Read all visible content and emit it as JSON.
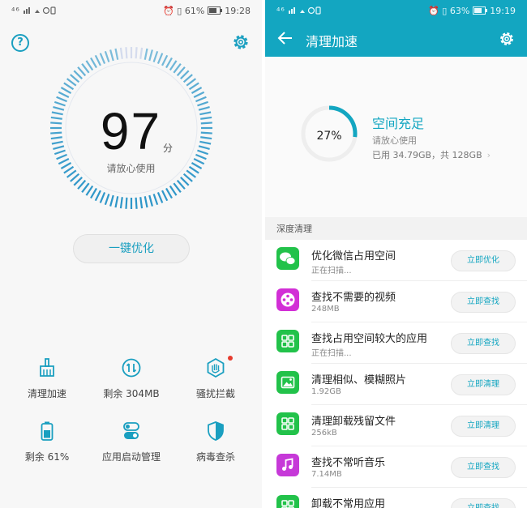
{
  "left": {
    "status": {
      "signal": "⁴⁶",
      "battery": "61%",
      "time": "19:28"
    },
    "score": "97",
    "score_unit": "分",
    "score_subtitle": "请放心使用",
    "optimize_label": "一键优化",
    "features": [
      {
        "label": "清理加速",
        "icon": "broom-icon"
      },
      {
        "label": "剩余 304MB",
        "icon": "memory-icon"
      },
      {
        "label": "骚扰拦截",
        "icon": "hand-block-icon"
      },
      {
        "label": "剩余 61%",
        "icon": "battery-icon"
      },
      {
        "label": "应用启动管理",
        "icon": "toggle-icon"
      },
      {
        "label": "病毒查杀",
        "icon": "shield-icon"
      }
    ]
  },
  "right": {
    "status": {
      "signal": "⁴⁶",
      "battery": "63%",
      "time": "19:19"
    },
    "title": "清理加速",
    "storage": {
      "percent_label": "27%",
      "percent": 27,
      "headline": "空间充足",
      "subtitle": "请放心使用",
      "detail": "已用 34.79GB，共 128GB"
    },
    "section_label": "深度清理",
    "items": [
      {
        "title": "优化微信占用空间",
        "sub": "正在扫描...",
        "button": "立即优化",
        "color": "#22c24a",
        "icon": "wechat-icon"
      },
      {
        "title": "查找不需要的视频",
        "sub": "248MB",
        "button": "立即查找",
        "color": "#d22fd6",
        "icon": "film-reel-icon"
      },
      {
        "title": "查找占用空间较大的应用",
        "sub": "正在扫描...",
        "button": "立即查找",
        "color": "#22c24a",
        "icon": "grid-apps-icon"
      },
      {
        "title": "清理相似、模糊照片",
        "sub": "1.92GB",
        "button": "立即清理",
        "color": "#22c24a",
        "icon": "photo-icon"
      },
      {
        "title": "清理卸载残留文件",
        "sub": "256kB",
        "button": "立即清理",
        "color": "#22c24a",
        "icon": "grid-apps-icon"
      },
      {
        "title": "查找不常听音乐",
        "sub": "7.14MB",
        "button": "立即查找",
        "color": "#c639d8",
        "icon": "music-note-icon"
      },
      {
        "title": "卸载不常用应用",
        "sub": "",
        "button": "立即查找",
        "color": "#22c24a",
        "icon": "grid-apps-icon"
      }
    ]
  },
  "colors": {
    "accent": "#13a6c1",
    "green": "#22c24a",
    "magenta": "#d22fd6",
    "badge": "#e63b2e"
  }
}
